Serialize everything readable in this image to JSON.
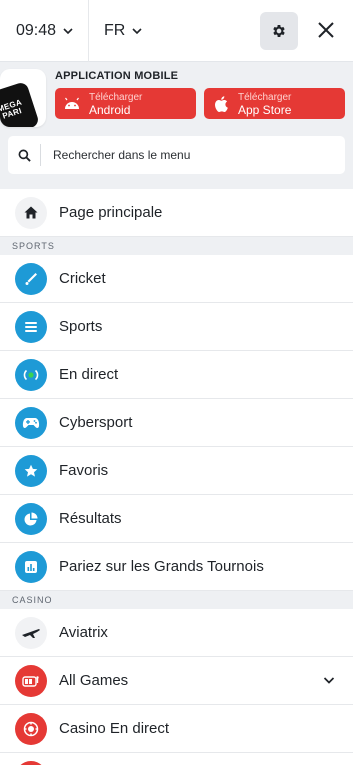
{
  "header": {
    "time": "09:48",
    "language": "FR"
  },
  "app_banner": {
    "title": "APPLICATION MOBILE",
    "logo_text": "MEGA PARI",
    "android": {
      "small": "Télécharger",
      "big": "Android"
    },
    "apple": {
      "small": "Télécharger",
      "big": "App Store"
    }
  },
  "search": {
    "placeholder": "Rechercher dans le menu"
  },
  "home": {
    "label": "Page principale",
    "icon": "home-icon"
  },
  "sections": {
    "sports": "SPORTS",
    "casino": "CASINO"
  },
  "sports_items": [
    {
      "label": "Cricket",
      "icon": "cricket-icon"
    },
    {
      "label": "Sports",
      "icon": "list-icon"
    },
    {
      "label": "En direct",
      "icon": "live-icon"
    },
    {
      "label": "Cybersport",
      "icon": "gamepad-icon"
    },
    {
      "label": "Favoris",
      "icon": "star-icon"
    },
    {
      "label": "Résultats",
      "icon": "pie-icon"
    },
    {
      "label": "Pariez sur les Grands Tournois",
      "icon": "chart-icon"
    }
  ],
  "casino_items": [
    {
      "label": "Aviatrix",
      "icon": "plane-icon"
    },
    {
      "label": "All Games",
      "icon": "slot-icon"
    },
    {
      "label": "Casino En direct",
      "icon": "chip-icon"
    }
  ],
  "colors": {
    "accent_red": "#e53935",
    "accent_blue": "#1e9ad6"
  }
}
